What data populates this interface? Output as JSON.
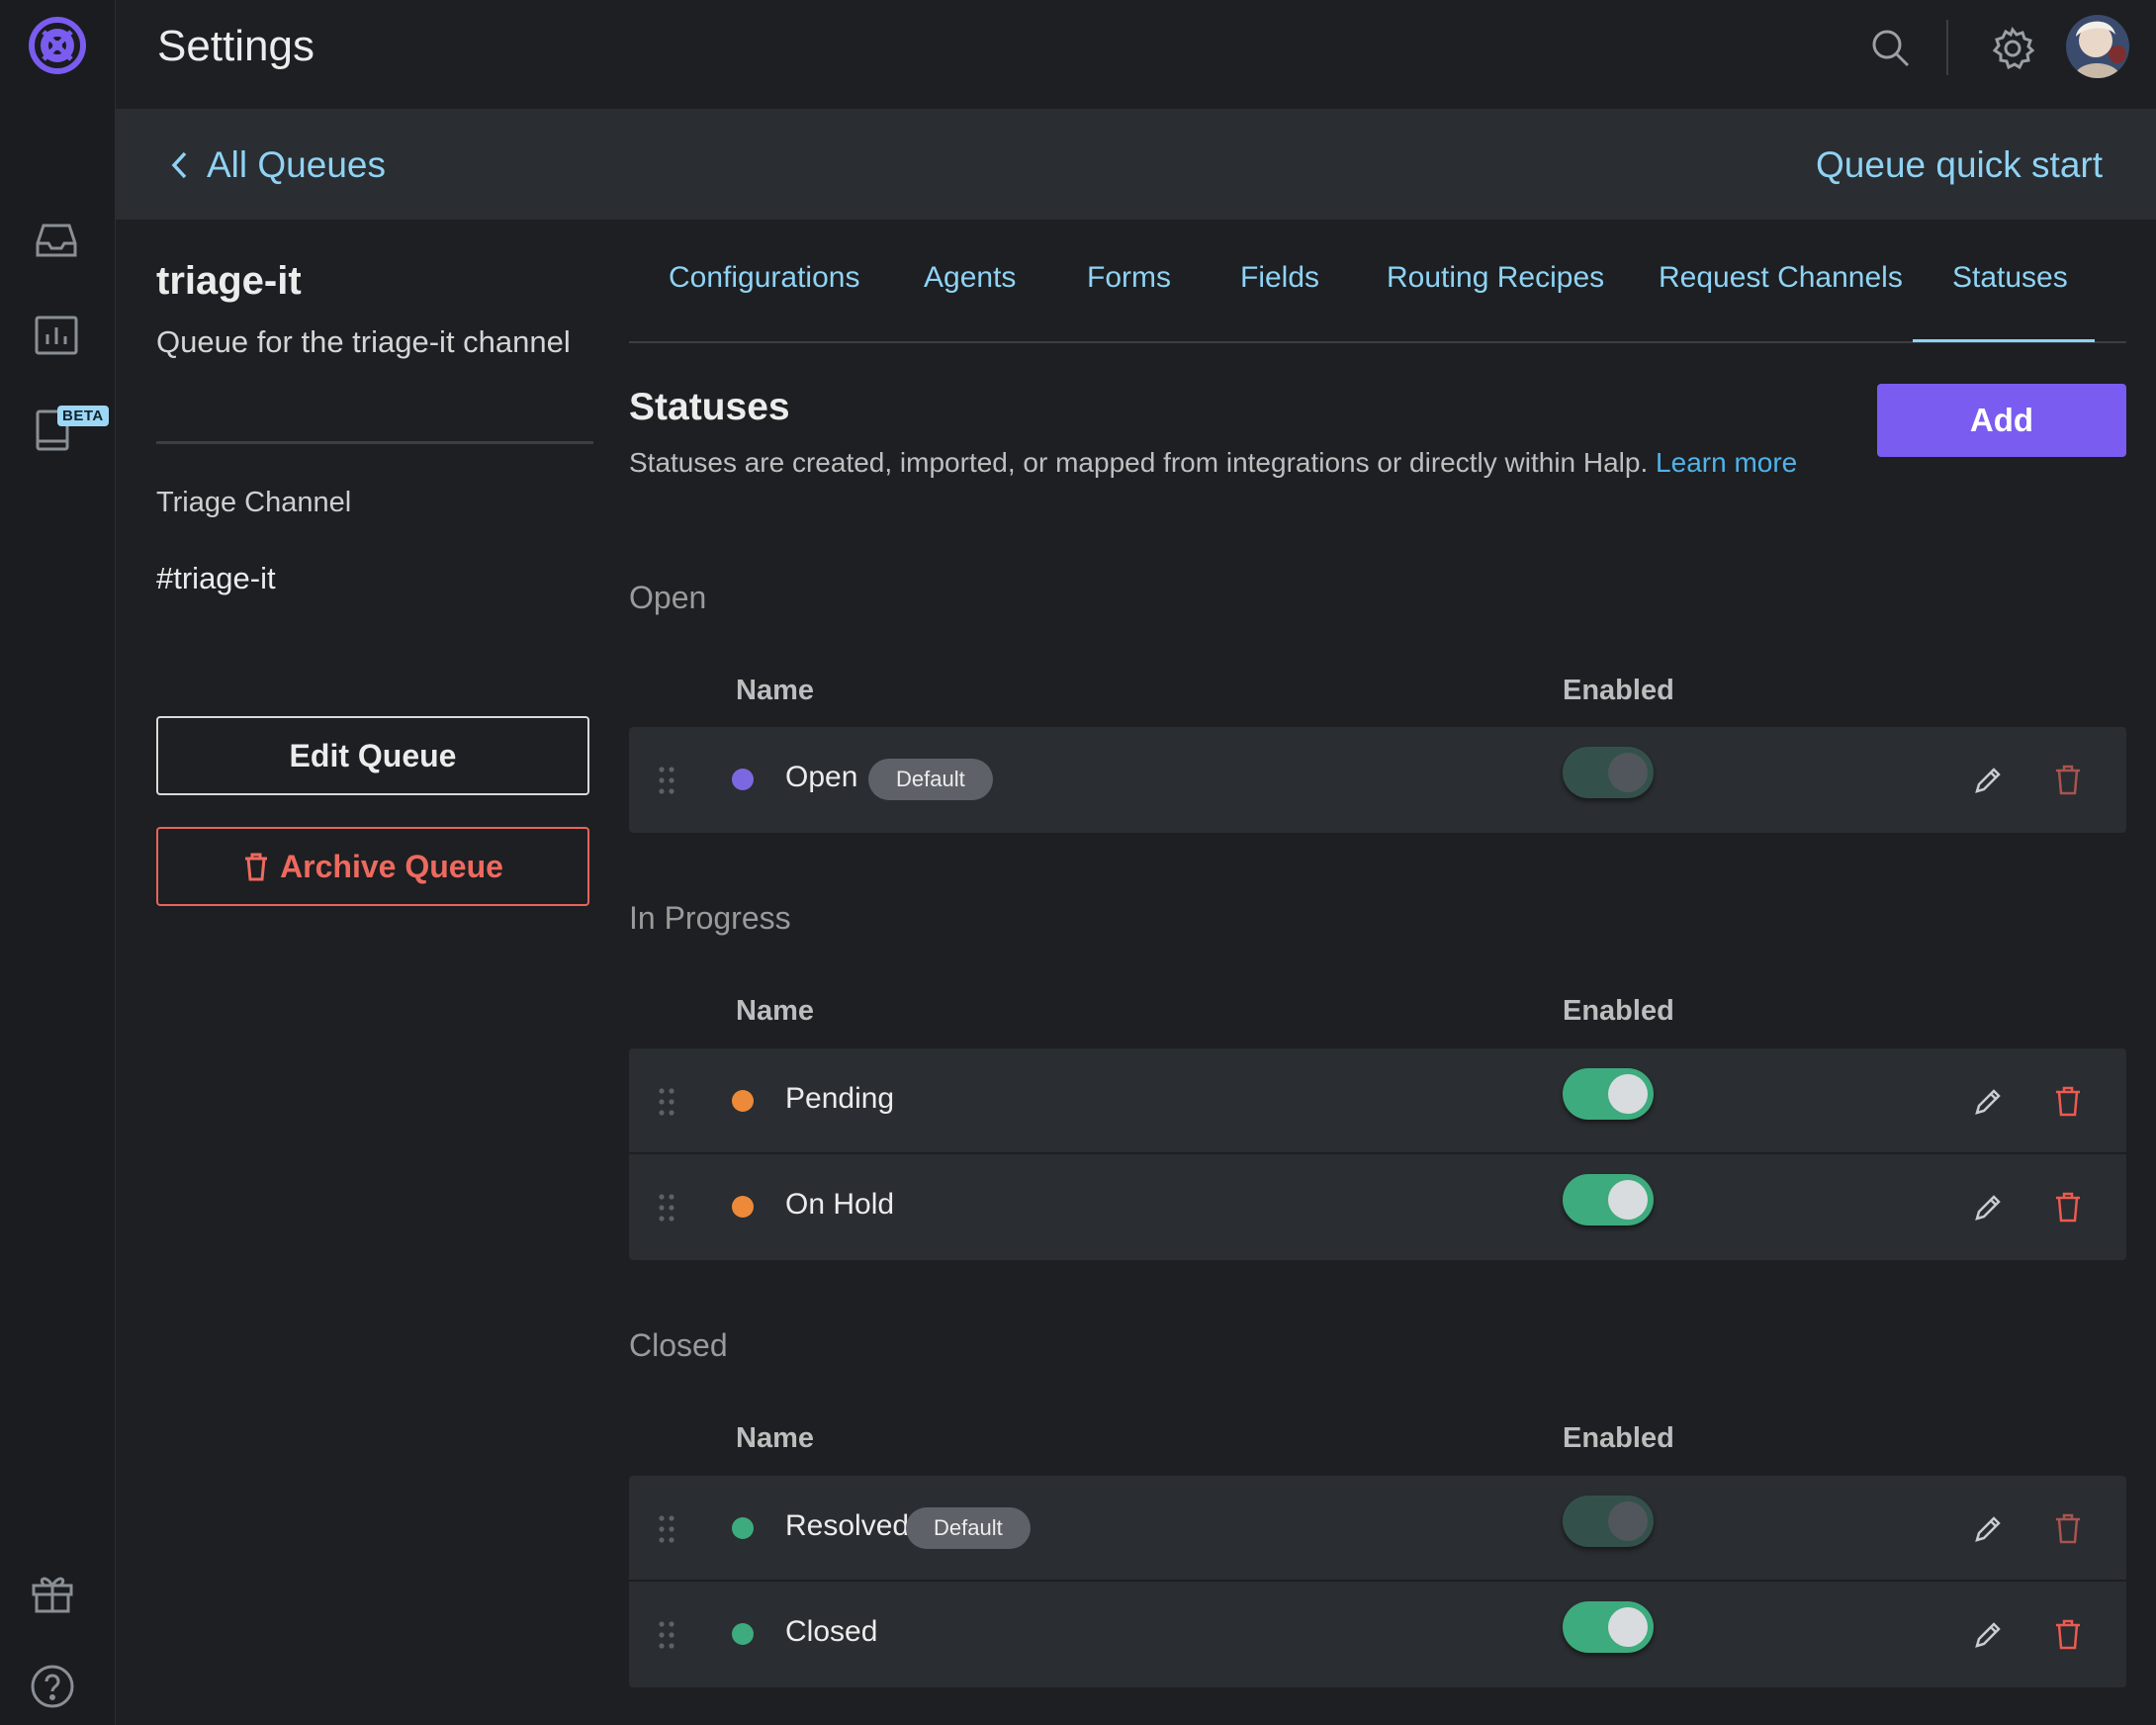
{
  "topbar": {
    "title": "Settings"
  },
  "rail": {
    "beta_label": "BETA"
  },
  "subbar": {
    "back_label": "All Queues",
    "quick_start_label": "Queue quick start"
  },
  "queue": {
    "name": "triage-it",
    "description": "Queue for the triage-it channel",
    "channel_label": "Triage Channel",
    "channel_value": "#triage-it",
    "edit_label": "Edit Queue",
    "archive_label": "Archive Queue"
  },
  "tabs": [
    {
      "label": "Configurations"
    },
    {
      "label": "Agents"
    },
    {
      "label": "Forms"
    },
    {
      "label": "Fields"
    },
    {
      "label": "Routing Recipes"
    },
    {
      "label": "Request Channels"
    },
    {
      "label": "Statuses",
      "active": true
    }
  ],
  "statuses": {
    "heading": "Statuses",
    "description": "Statuses are created, imported, or mapped from integrations or directly within Halp.",
    "learn_more": "Learn more",
    "add_label": "Add",
    "col_name": "Name",
    "col_enabled": "Enabled",
    "groups": [
      {
        "title": "Open",
        "rows": [
          {
            "name": "Open",
            "badge": "Default",
            "color": "#7b68e0",
            "enabled": false
          }
        ]
      },
      {
        "title": "In Progress",
        "rows": [
          {
            "name": "Pending",
            "color": "#ec8a3a",
            "enabled": true
          },
          {
            "name": "On Hold",
            "color": "#ec8a3a",
            "enabled": true
          }
        ]
      },
      {
        "title": "Closed",
        "rows": [
          {
            "name": "Resolved",
            "badge": "Default",
            "color": "#3dab7d",
            "enabled": false
          },
          {
            "name": "Closed",
            "color": "#3dab7d",
            "enabled": true
          }
        ]
      }
    ]
  },
  "colors": {
    "accent": "#7a5cf0",
    "link": "#8fd3f4",
    "danger": "#ee6a5f",
    "toggle_on": "#3dab7d"
  }
}
